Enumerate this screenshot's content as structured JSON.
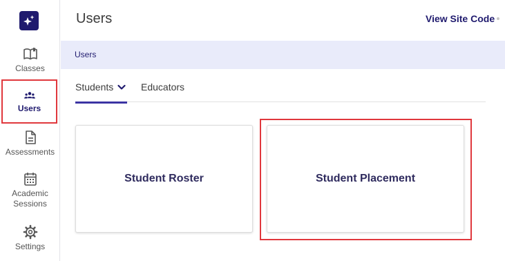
{
  "header": {
    "title": "Users",
    "site_code_link": "View Site Code"
  },
  "sidebar": {
    "logo_icon": "sparkle-logo-icon",
    "items": [
      {
        "label": "Classes",
        "icon": "book-icon"
      },
      {
        "label": "Users",
        "icon": "users-icon",
        "active": true
      },
      {
        "label": "Assessments",
        "icon": "document-icon"
      },
      {
        "label": "Academic Sessions",
        "icon": "calendar-icon"
      },
      {
        "label": "Settings",
        "icon": "gear-icon"
      }
    ]
  },
  "breadcrumb": {
    "current": "Users"
  },
  "tabs": [
    {
      "label": "Students",
      "active": true,
      "has_dropdown": true
    },
    {
      "label": "Educators",
      "active": false
    }
  ],
  "cards": [
    {
      "label": "Student Roster"
    },
    {
      "label": "Student Placement",
      "highlighted": true
    }
  ],
  "colors": {
    "brand_navy": "#1f1a6e",
    "breadcrumb_bg": "#e9ebfa",
    "tab_underline": "#3b34a3",
    "highlight_red": "#e0373c"
  }
}
